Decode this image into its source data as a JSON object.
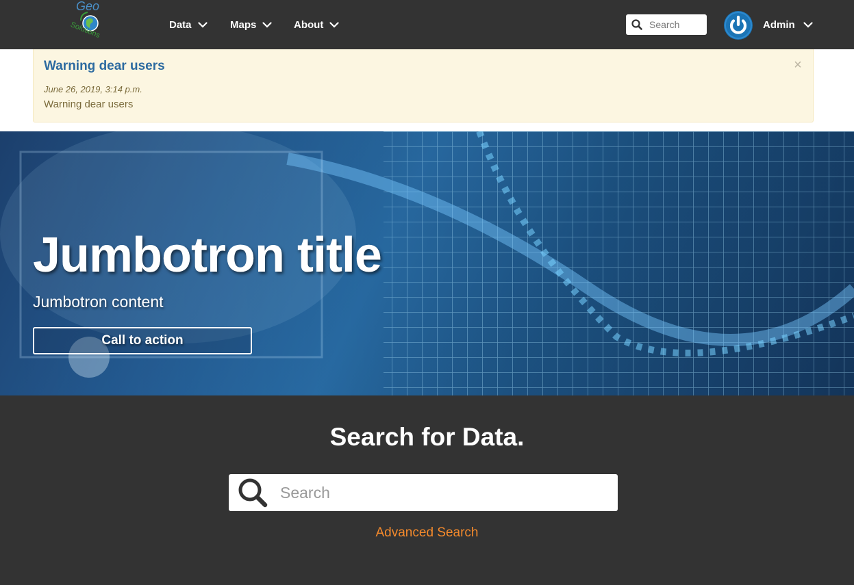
{
  "brand": {
    "logo_text_top": "Geo",
    "logo_text_bottom": "Solutions"
  },
  "nav": {
    "items": [
      {
        "label": "Data"
      },
      {
        "label": "Maps"
      },
      {
        "label": "About"
      }
    ],
    "search_placeholder": "Search",
    "user_label": "Admin"
  },
  "alert": {
    "title": "Warning dear users",
    "date": "June 26, 2019, 3:14 p.m.",
    "body": "Warning dear users",
    "close_glyph": "×"
  },
  "jumbotron": {
    "title": "Jumbotron title",
    "content": "Jumbotron content",
    "cta_label": "Call to action"
  },
  "search": {
    "title": "Search for Data.",
    "placeholder": "Search",
    "advanced_label": "Advanced Search"
  },
  "colors": {
    "navbar_bg": "#333333",
    "alert_bg": "#fcf6e1",
    "alert_title": "#2c6aa0",
    "avatar": "#1b74b5",
    "advanced_link": "#f58a2c"
  },
  "icons": [
    "logo-globe-icon",
    "chevron-down-icon",
    "search-icon",
    "power-icon",
    "close-icon"
  ]
}
